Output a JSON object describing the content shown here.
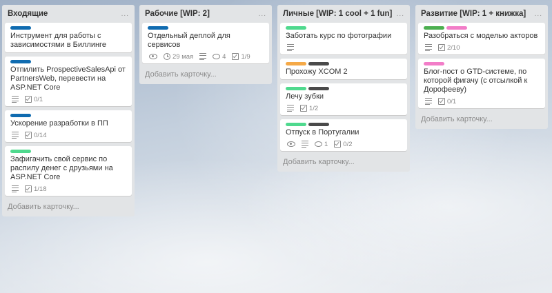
{
  "colors": {
    "blue": "#0f6bb0",
    "green": "#4fd98e",
    "darkgreen": "#4caf50",
    "pink": "#f27dc8",
    "orange": "#f5a947",
    "black": "#4a4a4a"
  },
  "add_card_label": "Добавить карточку...",
  "menu_icon": "...",
  "lists": [
    {
      "title": "Входящие",
      "cards": [
        {
          "labels": [
            "blue"
          ],
          "title": "Инструмент для работы с зависимостями в Биллинге",
          "badges": {}
        },
        {
          "labels": [
            "blue"
          ],
          "title": "Отпилить ProspectiveSalesApi от PartnersWeb, перевести на ASP.NET Core",
          "badges": {
            "description": true,
            "checklist": "0/1"
          }
        },
        {
          "labels": [
            "blue"
          ],
          "title": "Ускорение разработки в ПП",
          "badges": {
            "description": true,
            "checklist": "0/14"
          }
        },
        {
          "labels": [
            "green"
          ],
          "title": "Зафигачить свой сервис по распилу денег с друзьями на ASP.NET Core",
          "badges": {
            "description": true,
            "checklist": "1/18"
          }
        }
      ]
    },
    {
      "title": "Рабочие [WIP: 2]",
      "cards": [
        {
          "labels": [
            "blue"
          ],
          "title": "Отдельный деплой для сервисов",
          "badges": {
            "watch": true,
            "due": "29 мая",
            "description": true,
            "comments": "4",
            "checklist": "1/9"
          }
        }
      ]
    },
    {
      "title": "Личные [WIP: 1 cool + 1 fun]",
      "cards": [
        {
          "labels": [
            "green"
          ],
          "title": "Заботать курс по фотографии",
          "badges": {
            "description": true
          }
        },
        {
          "labels": [
            "orange",
            "black"
          ],
          "title": "Прохожу XCOM 2",
          "badges": {}
        },
        {
          "labels": [
            "green",
            "black"
          ],
          "title": "Лечу зубки",
          "badges": {
            "description": true,
            "checklist": "1/2"
          }
        },
        {
          "labels": [
            "green",
            "black"
          ],
          "title": "Отпуск в Португалии",
          "badges": {
            "watch": true,
            "description": true,
            "comments": "1",
            "checklist": "0/2"
          }
        }
      ]
    },
    {
      "title": "Развитие [WIP: 1 + книжка]",
      "cards": [
        {
          "labels": [
            "darkgreen",
            "pink"
          ],
          "title": "Разобраться с моделью акторов",
          "badges": {
            "description": true,
            "checklist": "2/10"
          }
        },
        {
          "labels": [
            "pink"
          ],
          "title": "Блог-пост о GTD-системе, по которой фигачу (с отсылкой к Дорофееву)",
          "badges": {
            "description": true,
            "checklist": "0/1"
          }
        }
      ]
    }
  ]
}
